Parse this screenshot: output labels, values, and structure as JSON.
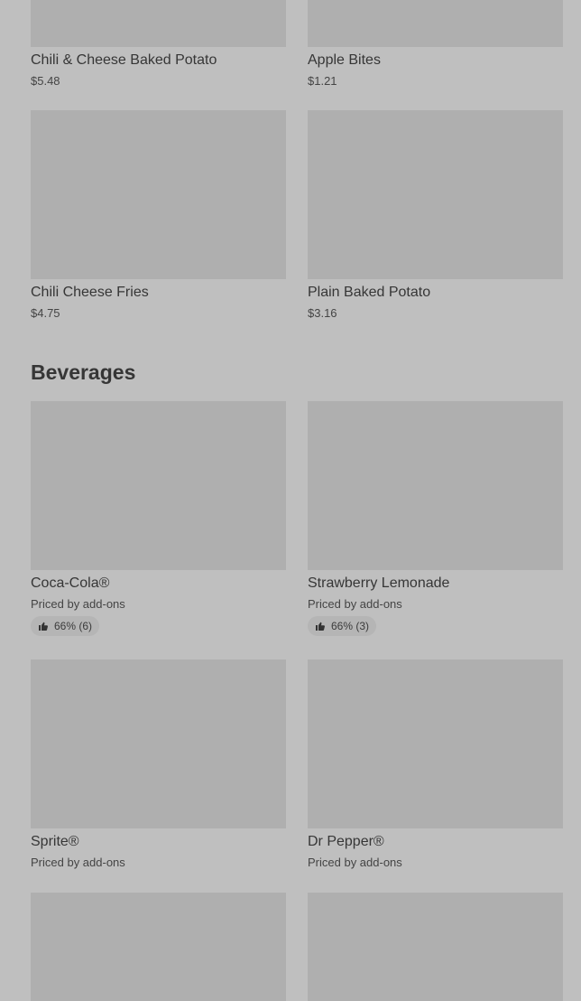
{
  "sections": {
    "sides": {
      "items": [
        {
          "name": "Chili & Cheese Baked Potato",
          "price": "$5.48"
        },
        {
          "name": "Apple Bites",
          "price": "$1.21"
        },
        {
          "name": "Chili Cheese Fries",
          "price": "$4.75"
        },
        {
          "name": "Plain Baked Potato",
          "price": "$3.16"
        }
      ]
    },
    "beverages": {
      "title": "Beverages",
      "items": [
        {
          "name": "Coca-Cola®",
          "price": "Priced by add-ons",
          "rating": "66% (6)"
        },
        {
          "name": "Strawberry Lemonade",
          "price": "Priced by add-ons",
          "rating": "66% (3)"
        },
        {
          "name": "Sprite®",
          "price": "Priced by add-ons"
        },
        {
          "name": "Dr Pepper®",
          "price": "Priced by add-ons"
        }
      ]
    }
  },
  "icons": {
    "rating": "thumbs-up-icon"
  },
  "colors": {
    "background": "#bfbfbf",
    "image_placeholder": "#afafaf",
    "text": "#363636",
    "rating_badge": "#b5b5b5"
  }
}
